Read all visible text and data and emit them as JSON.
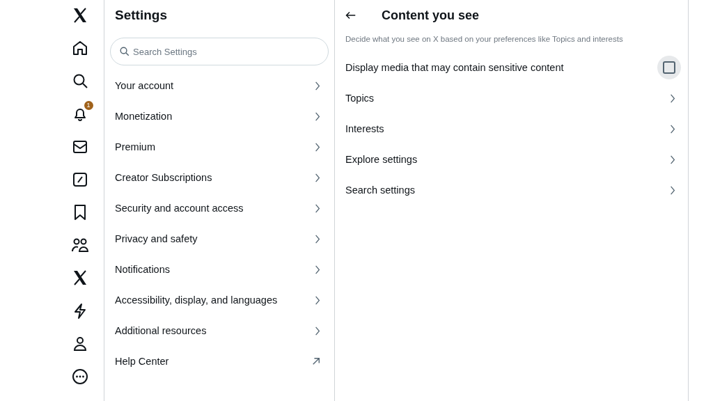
{
  "nav": {
    "notification_badge": "1"
  },
  "settings": {
    "title": "Settings",
    "search": {
      "placeholder": "Search Settings"
    },
    "items": [
      {
        "label": "Your account",
        "kind": "link"
      },
      {
        "label": "Monetization",
        "kind": "link"
      },
      {
        "label": "Premium",
        "kind": "link"
      },
      {
        "label": "Creator Subscriptions",
        "kind": "link"
      },
      {
        "label": "Security and account access",
        "kind": "link"
      },
      {
        "label": "Privacy and safety",
        "kind": "link"
      },
      {
        "label": "Notifications",
        "kind": "link"
      },
      {
        "label": "Accessibility, display, and languages",
        "kind": "link"
      },
      {
        "label": "Additional resources",
        "kind": "link"
      },
      {
        "label": "Help Center",
        "kind": "external"
      }
    ]
  },
  "detail": {
    "title": "Content you see",
    "description": "Decide what you see on X based on your preferences like Topics and interests",
    "rows": [
      {
        "label": "Display media that may contain sensitive content",
        "kind": "checkbox",
        "checked": false
      },
      {
        "label": "Topics",
        "kind": "link"
      },
      {
        "label": "Interests",
        "kind": "link"
      },
      {
        "label": "Explore settings",
        "kind": "link"
      },
      {
        "label": "Search settings",
        "kind": "link"
      }
    ]
  }
}
